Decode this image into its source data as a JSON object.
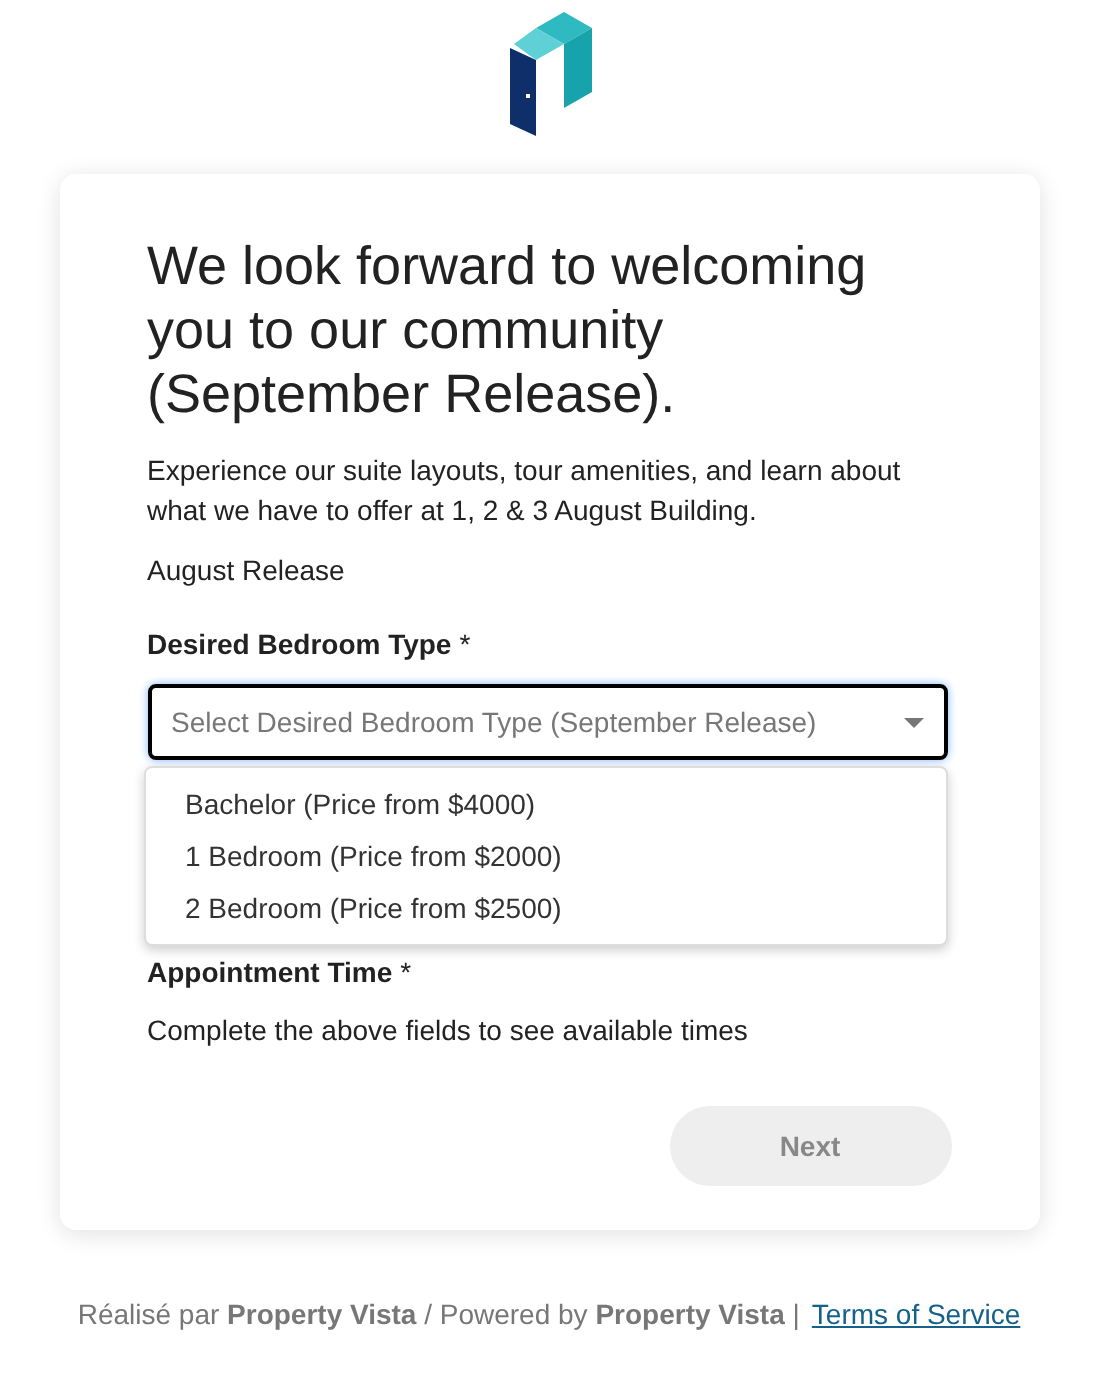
{
  "heading": "We look forward to welcoming you to our community (September Release).",
  "intro": "Experience our suite layouts, tour amenities, and learn about what we have to offer at 1, 2 & 3 August Building.",
  "release": "August Release",
  "bedroom_field": {
    "label": "Desired Bedroom Type",
    "required_mark": "*",
    "placeholder": "Select Desired Bedroom Type (September Release)",
    "expanded": true,
    "options": [
      {
        "label": "Bachelor (Price from $4000)",
        "selected": false
      },
      {
        "label": "1 Bedroom (Price from $2000)",
        "selected": false
      },
      {
        "label": "2 Bedroom (Price from $2500)",
        "selected": false
      }
    ]
  },
  "appointment": {
    "label": "Appointment Time",
    "required_mark": "*",
    "hint": "Complete the above fields to see available times"
  },
  "next_button": {
    "label": "Next",
    "disabled": true
  },
  "footer": {
    "credit": "Réalisé par **Property Vista** / Powered by **Property Vista** |",
    "link": "Terms of Service"
  }
}
